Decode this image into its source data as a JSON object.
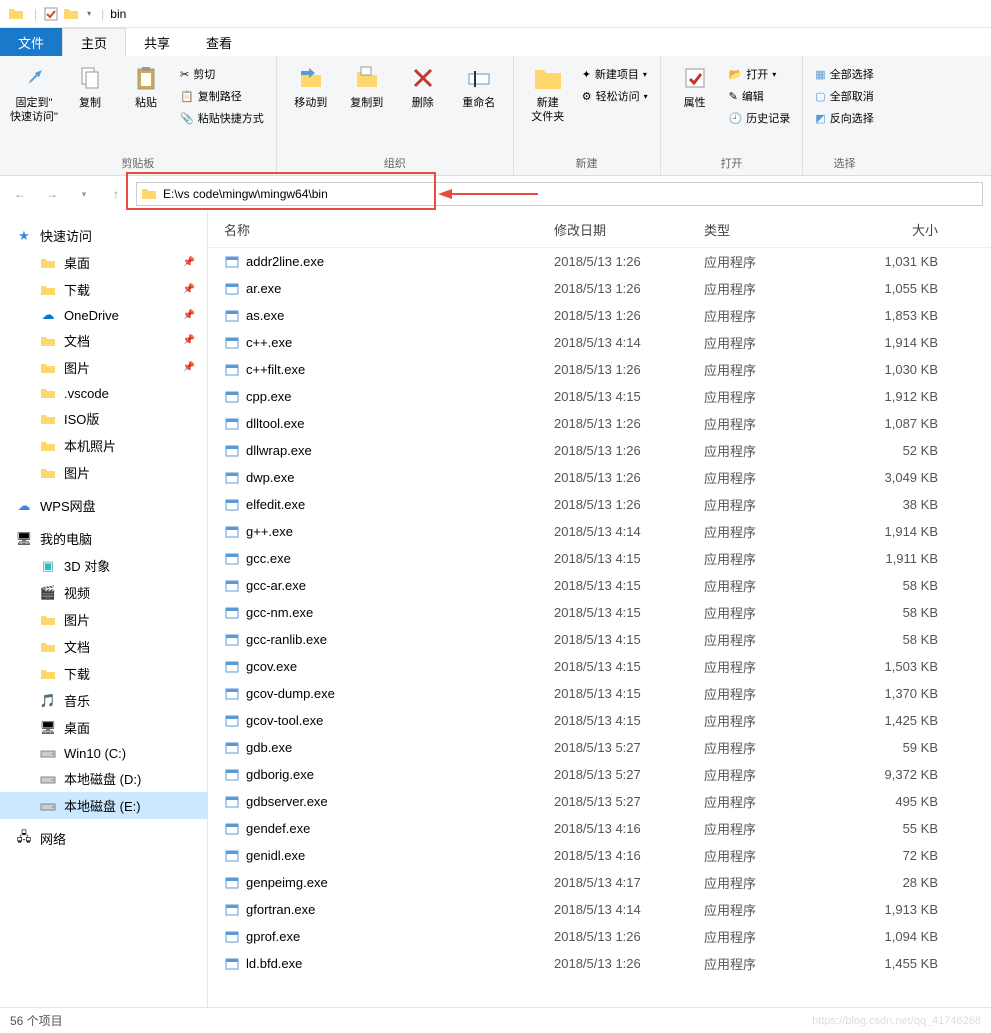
{
  "title": "bin",
  "tabs": {
    "file": "文件",
    "home": "主页",
    "share": "共享",
    "view": "查看"
  },
  "ribbon": {
    "clipboard": {
      "label": "剪贴板",
      "pin": "固定到\"\n快速访问\"",
      "copy": "复制",
      "paste": "粘贴",
      "cut": "剪切",
      "copypath": "复制路径",
      "pasteshortcut": "粘贴快捷方式"
    },
    "organize": {
      "label": "组织",
      "moveto": "移动到",
      "copyto": "复制到",
      "delete": "删除",
      "rename": "重命名"
    },
    "new": {
      "label": "新建",
      "newfolder": "新建\n文件夹",
      "newitem": "新建项目",
      "easyaccess": "轻松访问"
    },
    "open": {
      "label": "打开",
      "properties": "属性",
      "open": "打开",
      "edit": "编辑",
      "history": "历史记录"
    },
    "select": {
      "label": "选择",
      "selectall": "全部选择",
      "selectnone": "全部取消",
      "invert": "反向选择"
    }
  },
  "address": "E:\\vs code\\mingw\\mingw64\\bin",
  "columns": {
    "name": "名称",
    "date": "修改日期",
    "type": "类型",
    "size": "大小"
  },
  "sidebar": {
    "quick": "快速访问",
    "quickitems": [
      {
        "label": "桌面",
        "pin": true,
        "icon": "folder"
      },
      {
        "label": "下载",
        "pin": true,
        "icon": "folder"
      },
      {
        "label": "OneDrive",
        "pin": true,
        "icon": "onedrive"
      },
      {
        "label": "文档",
        "pin": true,
        "icon": "folder"
      },
      {
        "label": "图片",
        "pin": true,
        "icon": "folder"
      },
      {
        "label": ".vscode",
        "pin": false,
        "icon": "folder"
      },
      {
        "label": "ISO版",
        "pin": false,
        "icon": "folder"
      },
      {
        "label": "本机照片",
        "pin": false,
        "icon": "folder"
      },
      {
        "label": "图片",
        "pin": false,
        "icon": "folder"
      }
    ],
    "wps": "WPS网盘",
    "thispc": "我的电脑",
    "pcitems": [
      {
        "label": "3D 对象",
        "icon": "3d"
      },
      {
        "label": "视频",
        "icon": "video"
      },
      {
        "label": "图片",
        "icon": "pic"
      },
      {
        "label": "文档",
        "icon": "doc"
      },
      {
        "label": "下载",
        "icon": "dl"
      },
      {
        "label": "音乐",
        "icon": "music"
      },
      {
        "label": "桌面",
        "icon": "desktop"
      },
      {
        "label": "Win10 (C:)",
        "icon": "drive"
      },
      {
        "label": "本地磁盘 (D:)",
        "icon": "drive"
      },
      {
        "label": "本地磁盘 (E:)",
        "icon": "drive",
        "selected": true
      }
    ],
    "network": "网络"
  },
  "files": [
    {
      "name": "addr2line.exe",
      "date": "2018/5/13 1:26",
      "type": "应用程序",
      "size": "1,031 KB"
    },
    {
      "name": "ar.exe",
      "date": "2018/5/13 1:26",
      "type": "应用程序",
      "size": "1,055 KB"
    },
    {
      "name": "as.exe",
      "date": "2018/5/13 1:26",
      "type": "应用程序",
      "size": "1,853 KB"
    },
    {
      "name": "c++.exe",
      "date": "2018/5/13 4:14",
      "type": "应用程序",
      "size": "1,914 KB"
    },
    {
      "name": "c++filt.exe",
      "date": "2018/5/13 1:26",
      "type": "应用程序",
      "size": "1,030 KB"
    },
    {
      "name": "cpp.exe",
      "date": "2018/5/13 4:15",
      "type": "应用程序",
      "size": "1,912 KB"
    },
    {
      "name": "dlltool.exe",
      "date": "2018/5/13 1:26",
      "type": "应用程序",
      "size": "1,087 KB"
    },
    {
      "name": "dllwrap.exe",
      "date": "2018/5/13 1:26",
      "type": "应用程序",
      "size": "52 KB"
    },
    {
      "name": "dwp.exe",
      "date": "2018/5/13 1:26",
      "type": "应用程序",
      "size": "3,049 KB"
    },
    {
      "name": "elfedit.exe",
      "date": "2018/5/13 1:26",
      "type": "应用程序",
      "size": "38 KB"
    },
    {
      "name": "g++.exe",
      "date": "2018/5/13 4:14",
      "type": "应用程序",
      "size": "1,914 KB"
    },
    {
      "name": "gcc.exe",
      "date": "2018/5/13 4:15",
      "type": "应用程序",
      "size": "1,911 KB"
    },
    {
      "name": "gcc-ar.exe",
      "date": "2018/5/13 4:15",
      "type": "应用程序",
      "size": "58 KB"
    },
    {
      "name": "gcc-nm.exe",
      "date": "2018/5/13 4:15",
      "type": "应用程序",
      "size": "58 KB"
    },
    {
      "name": "gcc-ranlib.exe",
      "date": "2018/5/13 4:15",
      "type": "应用程序",
      "size": "58 KB"
    },
    {
      "name": "gcov.exe",
      "date": "2018/5/13 4:15",
      "type": "应用程序",
      "size": "1,503 KB"
    },
    {
      "name": "gcov-dump.exe",
      "date": "2018/5/13 4:15",
      "type": "应用程序",
      "size": "1,370 KB"
    },
    {
      "name": "gcov-tool.exe",
      "date": "2018/5/13 4:15",
      "type": "应用程序",
      "size": "1,425 KB"
    },
    {
      "name": "gdb.exe",
      "date": "2018/5/13 5:27",
      "type": "应用程序",
      "size": "59 KB"
    },
    {
      "name": "gdborig.exe",
      "date": "2018/5/13 5:27",
      "type": "应用程序",
      "size": "9,372 KB"
    },
    {
      "name": "gdbserver.exe",
      "date": "2018/5/13 5:27",
      "type": "应用程序",
      "size": "495 KB"
    },
    {
      "name": "gendef.exe",
      "date": "2018/5/13 4:16",
      "type": "应用程序",
      "size": "55 KB"
    },
    {
      "name": "genidl.exe",
      "date": "2018/5/13 4:16",
      "type": "应用程序",
      "size": "72 KB"
    },
    {
      "name": "genpeimg.exe",
      "date": "2018/5/13 4:17",
      "type": "应用程序",
      "size": "28 KB"
    },
    {
      "name": "gfortran.exe",
      "date": "2018/5/13 4:14",
      "type": "应用程序",
      "size": "1,913 KB"
    },
    {
      "name": "gprof.exe",
      "date": "2018/5/13 1:26",
      "type": "应用程序",
      "size": "1,094 KB"
    },
    {
      "name": "ld.bfd.exe",
      "date": "2018/5/13 1:26",
      "type": "应用程序",
      "size": "1,455 KB"
    }
  ],
  "status": "56 个项目",
  "watermark": "https://blog.csdn.net/qq_41746268"
}
